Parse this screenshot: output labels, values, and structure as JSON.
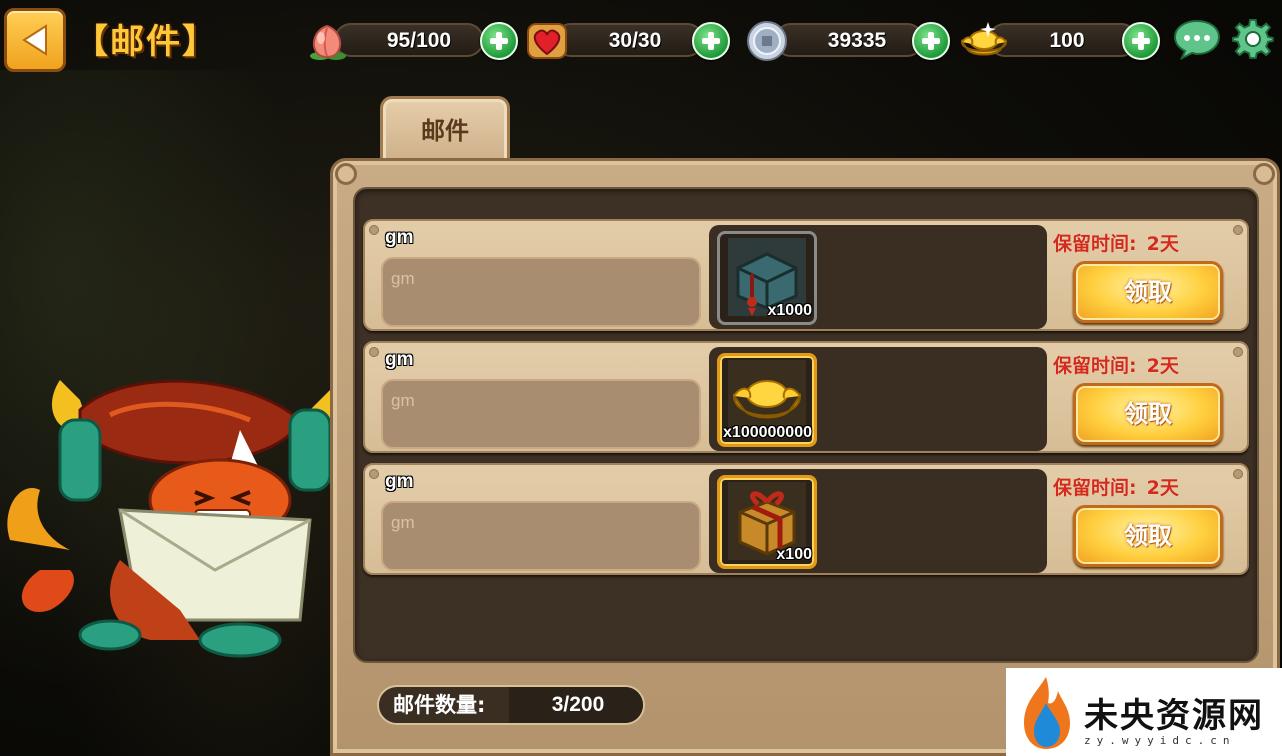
{
  "header": {
    "title": "【邮件】"
  },
  "resources": {
    "stamina": "95/100",
    "energy": "30/30",
    "silver": "39335",
    "gold": "100"
  },
  "tabs": [
    {
      "label": "邮件",
      "active": true
    }
  ],
  "mail": {
    "retain_label": "保留时间:",
    "claim_label": "领取",
    "items": [
      {
        "sender": "gm",
        "body": "gm",
        "item_icon": "treasure-chest-icon",
        "item_qty": "x1000",
        "retain_days": "2天"
      },
      {
        "sender": "gm",
        "body": "gm",
        "item_icon": "gold-ingot-icon",
        "item_qty": "x100000000",
        "retain_days": "2天"
      },
      {
        "sender": "gm",
        "body": "gm",
        "item_icon": "gift-box-icon",
        "item_qty": "x100",
        "retain_days": "2天"
      }
    ],
    "count_label": "邮件数量:",
    "count_value": "3/200"
  },
  "watermark": {
    "title": "未央资源网",
    "subtitle": "zy.wyyidc.cn"
  },
  "colors": {
    "accent_gold": "#ffc83a",
    "retain_red": "#d22a1e",
    "plus_green": "#1f9a3a",
    "panel_tan": "#c9ac86"
  }
}
